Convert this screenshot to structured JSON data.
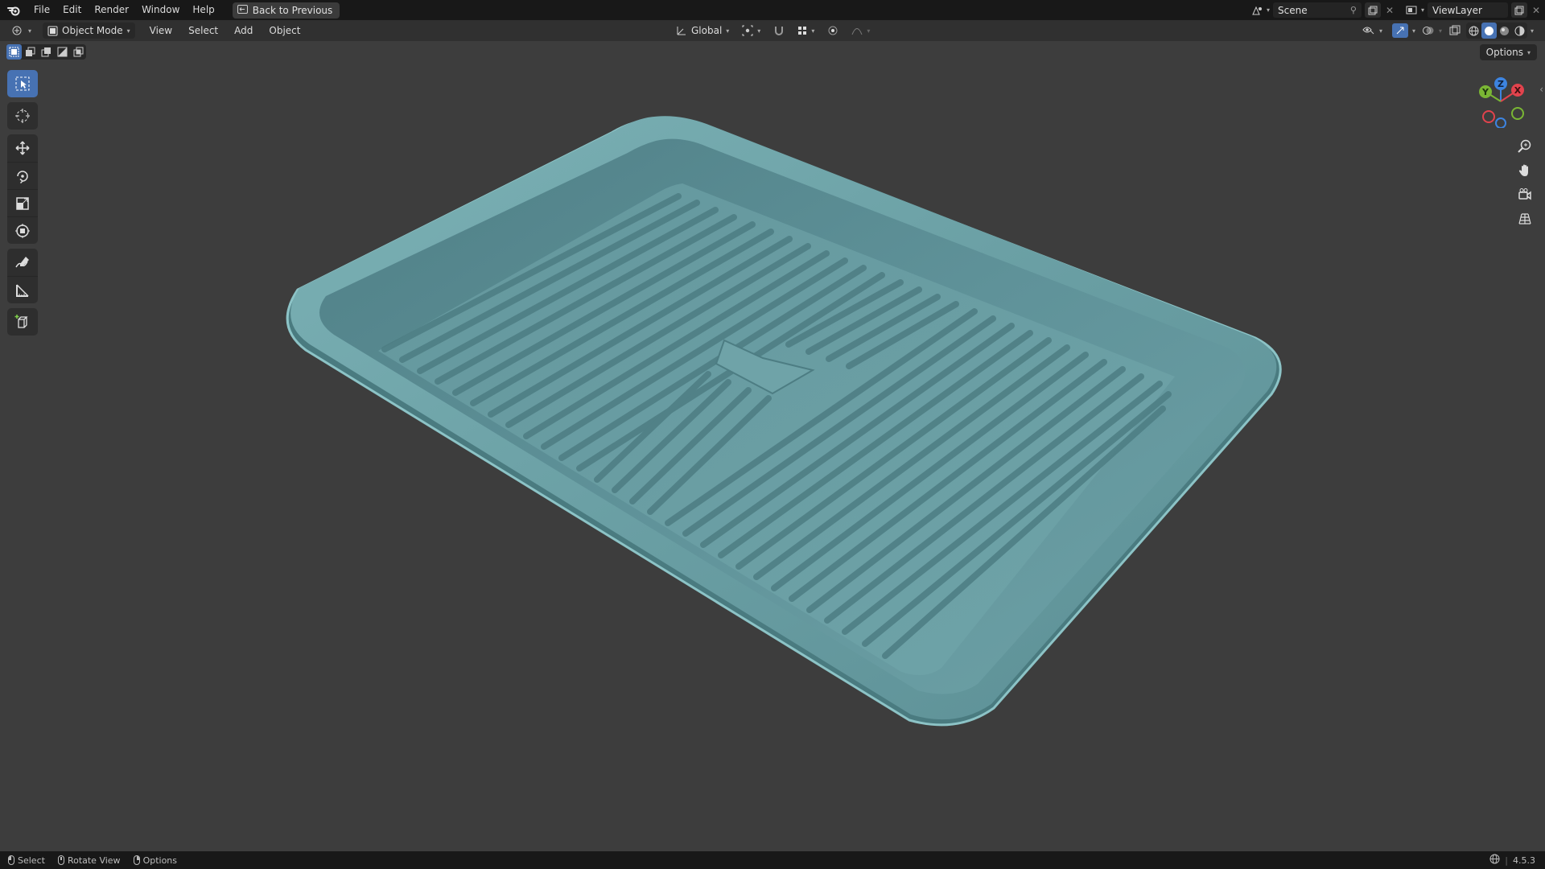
{
  "topbar": {
    "menus": [
      "File",
      "Edit",
      "Render",
      "Window",
      "Help"
    ],
    "back_button": "Back to Previous",
    "scene_name": "Scene",
    "view_layer": "ViewLayer"
  },
  "viewport_header": {
    "mode": "Object Mode",
    "menus": [
      "View",
      "Select",
      "Add",
      "Object"
    ],
    "transform_orientation": "Global",
    "options_label": "Options"
  },
  "tools": [
    "select-box",
    "cursor",
    "move",
    "rotate",
    "scale",
    "transform",
    "annotate",
    "measure",
    "add-cube"
  ],
  "gizmo": {
    "x_label": "X",
    "y_label": "Y",
    "z_label": "Z"
  },
  "statusbar": {
    "items": [
      "Select",
      "Rotate View",
      "Options"
    ],
    "version": "4.5.3"
  },
  "colors": {
    "accent": "#4772b3",
    "model": "#6fa3a8",
    "axis_x": "#e2434d",
    "axis_y": "#7ab634",
    "axis_z": "#3d84e0"
  }
}
